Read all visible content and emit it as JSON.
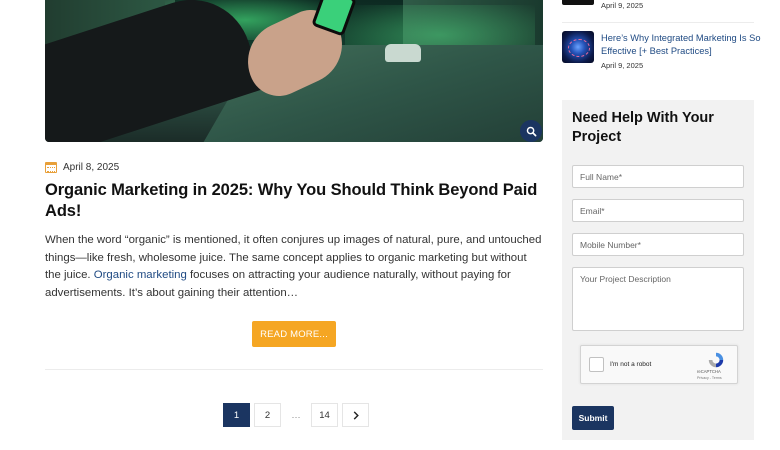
{
  "post": {
    "date": "April 8, 2025",
    "title": "Organic Marketing in 2025: Why You Should Think Beyond Paid Ads!",
    "excerpt_part1": "When the word “organic” is mentioned, it often conjures up images of natural, pure, and untouched things—like fresh, wholesome juice. The same concept applies to organic marketing but without the juice. ",
    "excerpt_link": "Organic marketing",
    "excerpt_part2": " focuses on attracting your audience naturally, without paying for advertisements. It’s about gaining their attention…",
    "read_more": "READ MORE..."
  },
  "pagination": {
    "pages": [
      "1",
      "2",
      "…",
      "14"
    ],
    "current": "1",
    "next_icon": "chevron-right-icon"
  },
  "sidebar": {
    "recent_posts": [
      {
        "date": "April 9, 2025"
      },
      {
        "title": "Here’s Why Integrated Marketing Is So Effective [+ Best Practices]",
        "date": "April 9, 2025"
      }
    ],
    "form": {
      "title": "Need Help With Your Project",
      "full_name_placeholder": "Full Name*",
      "email_placeholder": "Email*",
      "mobile_placeholder": "Mobile Number*",
      "description_placeholder": "Your Project Description",
      "captcha_label": "I'm not a robot",
      "captcha_brand": "reCAPTCHA",
      "captcha_terms": "Privacy - Terms",
      "submit": "Submit"
    }
  },
  "colors": {
    "brand_navy": "#1b3561",
    "accent_orange": "#f5a623",
    "link_blue": "#1f4a83"
  }
}
